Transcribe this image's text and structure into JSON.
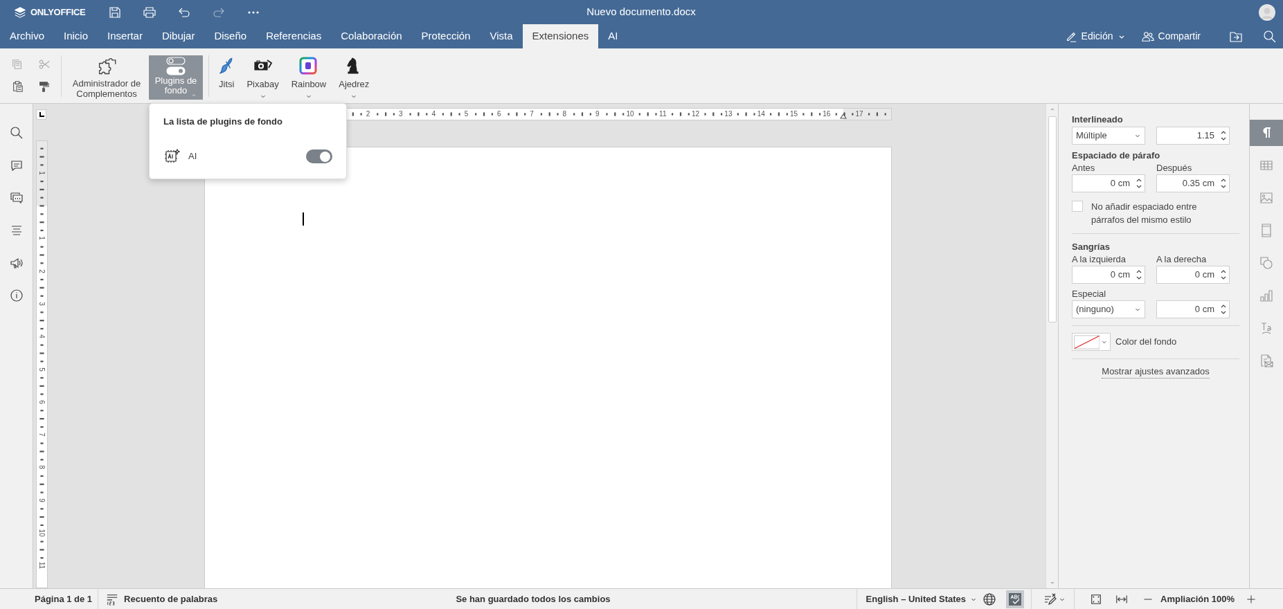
{
  "app": {
    "logo": "ONLYOFFICE",
    "title": "Nuevo documento.docx"
  },
  "menu_tabs": [
    {
      "label": "Archivo",
      "selected": false
    },
    {
      "label": "Inicio",
      "selected": false
    },
    {
      "label": "Insertar",
      "selected": false
    },
    {
      "label": "Dibujar",
      "selected": false
    },
    {
      "label": "Diseño",
      "selected": false
    },
    {
      "label": "Referencias",
      "selected": false
    },
    {
      "label": "Colaboración",
      "selected": false
    },
    {
      "label": "Protección",
      "selected": false
    },
    {
      "label": "Vista",
      "selected": false
    },
    {
      "label": "Extensiones",
      "selected": true
    },
    {
      "label": "AI",
      "selected": false
    }
  ],
  "header_actions": {
    "mode": "Edición",
    "share": "Compartir"
  },
  "toolbar": {
    "plugins_manager": "Administrador de Complementos",
    "background_plugins": {
      "label": "Plugins de fondo",
      "expanded": true
    },
    "plugins": [
      {
        "kind": "jitsi",
        "label": "Jitsi",
        "has_menu": false
      },
      {
        "kind": "pixabay",
        "label": "Pixabay",
        "has_menu": true
      },
      {
        "kind": "rainbow",
        "label": "Rainbow",
        "has_menu": true
      },
      {
        "kind": "chess",
        "label": "Ajedrez",
        "has_menu": true
      }
    ]
  },
  "popup": {
    "title": "La lista de plugins de fondo",
    "items": [
      {
        "label": "AI",
        "on": true
      }
    ]
  },
  "horizontal_ruler": {
    "labels": [
      "2",
      "3",
      "4",
      "5",
      "6",
      "7",
      "8",
      "9",
      "10",
      "11",
      "12",
      "13",
      "14",
      "15",
      "16",
      "17"
    ]
  },
  "vertical_ruler": {
    "labels": [
      "1",
      "1",
      "2",
      "3",
      "4",
      "5",
      "6",
      "7",
      "8",
      "9",
      "10",
      "11"
    ]
  },
  "paragraph_settings": {
    "line_spacing": {
      "heading": "Interlineado",
      "mode": "Múltiple",
      "value": "1.15"
    },
    "paragraph_spacing": {
      "heading": "Espaciado de párafo",
      "before_label": "Antes",
      "before": "0 cm",
      "after_label": "Después",
      "after": "0.35 cm"
    },
    "no_space": {
      "label": "No añadir espaciado entre párrafos del mismo estilo",
      "checked": false
    },
    "indents": {
      "heading": "Sangrías",
      "left_label": "A la izquierda",
      "left": "0 cm",
      "right_label": "A la derecha",
      "right": "0 cm",
      "special_label": "Especial",
      "special": "(ninguno)",
      "special_value": "0 cm"
    },
    "background_color": {
      "label": "Color del fondo"
    },
    "advanced_link": "Mostrar ajustes avanzados"
  },
  "right_tabs": [
    {
      "kind": "paragraph",
      "selected": true
    },
    {
      "kind": "table",
      "selected": false
    },
    {
      "kind": "image",
      "selected": false
    },
    {
      "kind": "header",
      "selected": false
    },
    {
      "kind": "shape",
      "selected": false
    },
    {
      "kind": "chart",
      "selected": false
    },
    {
      "kind": "textart",
      "selected": false
    },
    {
      "kind": "mailmerge",
      "selected": false
    }
  ],
  "status_bar": {
    "page": "Página 1 de 1",
    "word_count": "Recuento de palabras",
    "save_status": "Se han guardado todos los cambios",
    "language": "English – United States",
    "spellcheck_on": true,
    "zoom": "Ampliación 100%"
  }
}
